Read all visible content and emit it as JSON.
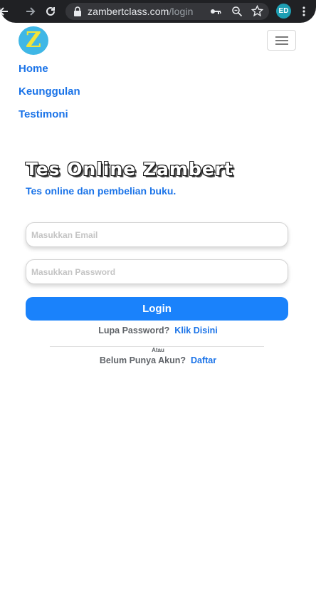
{
  "browser": {
    "url_host": "zambertclass.com",
    "url_path": "/login",
    "profile_initials": "ED"
  },
  "navbar": {
    "logo_letter": "Z",
    "links": [
      {
        "label": "Home"
      },
      {
        "label": "Keunggulan"
      },
      {
        "label": "Testimoni"
      }
    ]
  },
  "hero": {
    "title": "Tes Online Zambert",
    "subtitle": "Tes online dan pembelian buku."
  },
  "form": {
    "email_placeholder": "Masukkan Email",
    "password_placeholder": "Masukkan Password",
    "login_label": "Login",
    "forgot_text": "Lupa Password?",
    "forgot_link": "Klik Disini",
    "divider_label": "Atau",
    "register_text": "Belum Punya Akun?",
    "register_link": "Daftar"
  },
  "colors": {
    "accent": "#1a73e8",
    "button": "#1a82fb",
    "chrome": "#202124",
    "logo_bg": "#3fb7e6",
    "logo_letter": "#f2e43a"
  }
}
